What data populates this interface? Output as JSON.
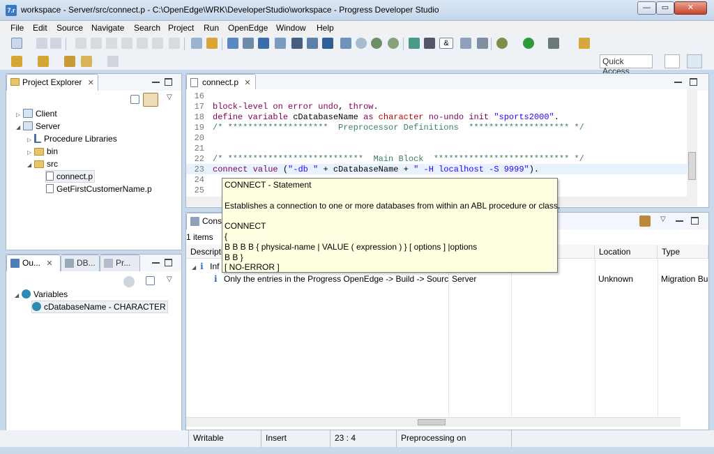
{
  "window": {
    "title": "workspace - Server/src/connect.p - C:\\OpenEdge\\WRK\\DeveloperStudio\\workspace - Progress Developer Studio",
    "app_icon_text": "7.r"
  },
  "menu": [
    "File",
    "Edit",
    "Source",
    "Navigate",
    "Search",
    "Project",
    "Run",
    "OpenEdge",
    "Window",
    "Help"
  ],
  "quick_access": "Quick Access",
  "project_explorer": {
    "tab_label": "Project Explorer",
    "items": [
      {
        "label": "Client",
        "level": 1,
        "icon": "project-icon",
        "expanded": false
      },
      {
        "label": "Server",
        "level": 1,
        "icon": "project-icon",
        "expanded": true
      },
      {
        "label": "Procedure Libraries",
        "level": 2,
        "icon": "library-icon",
        "expanded": false
      },
      {
        "label": "bin",
        "level": 2,
        "icon": "folder-icon",
        "expanded": false
      },
      {
        "label": "src",
        "level": 2,
        "icon": "folder-open-icon",
        "expanded": true
      },
      {
        "label": "connect.p",
        "level": 3,
        "icon": "procedure-file-icon",
        "selected": true
      },
      {
        "label": "GetFirstCustomerName.p",
        "level": 3,
        "icon": "procedure-file-icon"
      }
    ]
  },
  "outline": {
    "tabs": [
      "Ou...",
      "DB...",
      "Pr..."
    ],
    "items": [
      {
        "label": "Variables",
        "level": 1
      },
      {
        "label": "cDatabaseName - CHARACTER",
        "level": 2,
        "selected": true
      }
    ]
  },
  "editor": {
    "tab_label": "connect.p",
    "lines": [
      {
        "no": "16",
        "text": ""
      },
      {
        "no": "17",
        "text": "block-level on error undo, throw."
      },
      {
        "no": "18",
        "text": "define variable cDatabaseName as character no-undo init \"sports2000\"."
      },
      {
        "no": "19",
        "text": "/* ********************  Preprocessor Definitions  ******************** */"
      },
      {
        "no": "20",
        "text": ""
      },
      {
        "no": "21",
        "text": ""
      },
      {
        "no": "22",
        "text": "/* ***************************  Main Block  *************************** */"
      },
      {
        "no": "23",
        "text": "connect value (\"-db \" + cDatabaseName + \" -H localhost -S 9999\")."
      },
      {
        "no": "24",
        "text": ""
      },
      {
        "no": "25",
        "text": ""
      }
    ]
  },
  "tooltip": {
    "title": "CONNECT - Statement",
    "description": "Establishes a connection to one or more databases from within an ABL procedure or class.",
    "syntax": [
      "CONNECT",
      "{",
      "B B B B { physical-name | VALUE ( expression ) } [ options ] |options",
      "B B }",
      "[ NO-ERROR ]"
    ]
  },
  "console": {
    "tab_label": "Cons",
    "count": "1 items",
    "columns": [
      "Descripti",
      "",
      "",
      "Location",
      "Type"
    ],
    "rows": [
      {
        "description": "Inf",
        "resource": "",
        "path": "",
        "location": "",
        "type": ""
      },
      {
        "description": "Only the entries in the Progress OpenEdge -> Build -> Source",
        "resource": "Server",
        "path": "",
        "location": "Unknown",
        "type": "Migration Bu"
      }
    ]
  },
  "status": {
    "writable": "Writable",
    "insert": "Insert",
    "position": "23 : 4",
    "activity": "Preprocessing on"
  }
}
